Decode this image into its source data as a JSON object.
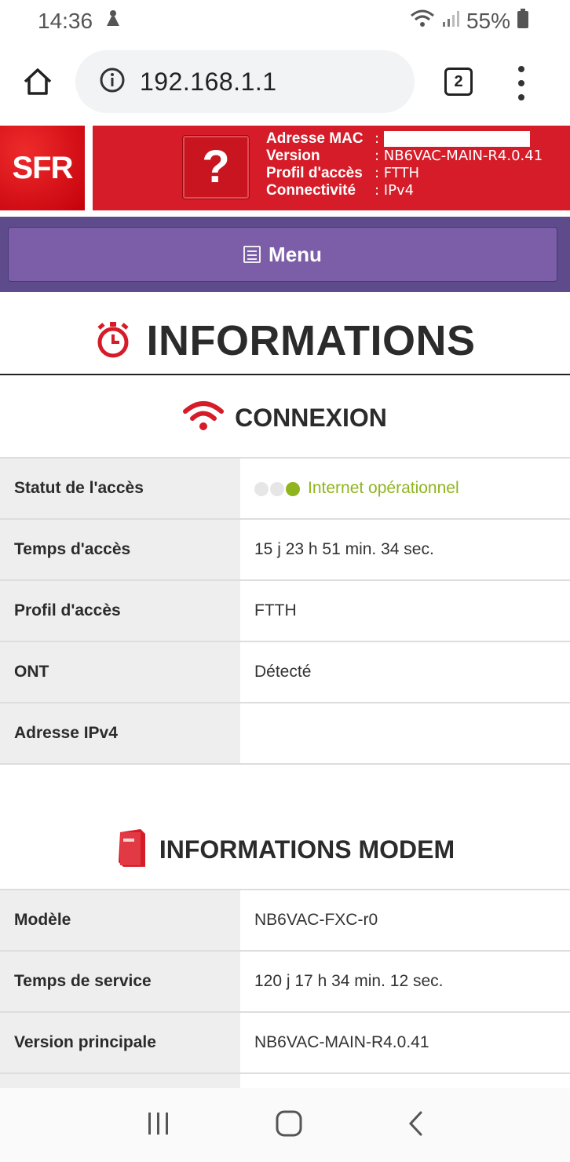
{
  "status_bar": {
    "time": "14:36",
    "battery": "55%"
  },
  "browser": {
    "url": "192.168.1.1",
    "tab_count": "2"
  },
  "header": {
    "logo_text": "SFR",
    "help_symbol": "?",
    "info": [
      {
        "key": "Adresse MAC",
        "value": ""
      },
      {
        "key": "Version",
        "value": "NB6VAC-MAIN-R4.0.41"
      },
      {
        "key": "Profil d'accès",
        "value": "FTTH"
      },
      {
        "key": "Connectivité",
        "value": "IPv4"
      }
    ]
  },
  "menu": {
    "label": "Menu"
  },
  "page": {
    "title": "INFORMATIONS"
  },
  "connexion": {
    "title": "CONNEXION",
    "rows": [
      {
        "label": "Statut de l'accès",
        "value": "Internet opérationnel"
      },
      {
        "label": "Temps d'accès",
        "value": "15 j 23 h 51 min. 34 sec."
      },
      {
        "label": "Profil d'accès",
        "value": "FTTH"
      },
      {
        "label": "ONT",
        "value": "Détecté"
      },
      {
        "label": "Adresse IPv4",
        "value": ""
      }
    ]
  },
  "modem": {
    "title": "INFORMATIONS MODEM",
    "rows": [
      {
        "label": "Modèle",
        "value": "NB6VAC-FXC-r0"
      },
      {
        "label": "Temps de service",
        "value": "120 j 17 h 34 min. 12 sec."
      },
      {
        "label": "Version principale",
        "value": "NB6VAC-MAIN-R4.0.41"
      }
    ]
  },
  "colors": {
    "sfr_red": "#d51c28",
    "menu_purple": "#7b5ea7",
    "status_green": "#8fb51e"
  },
  "icons": [
    "home-icon",
    "info-icon",
    "tabs-icon",
    "more-icon",
    "stopwatch-icon",
    "wifi-icon",
    "modem-icon",
    "recents-icon",
    "home-nav-icon",
    "back-icon"
  ]
}
